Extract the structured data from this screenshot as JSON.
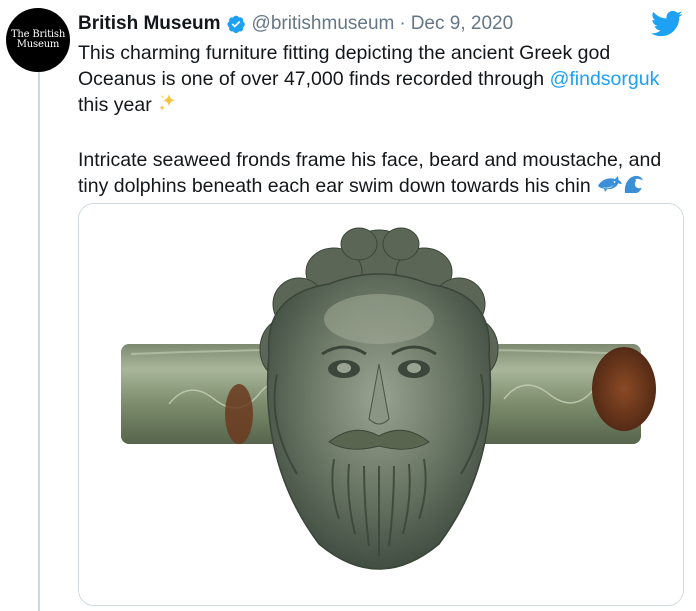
{
  "account": {
    "display_name": "British Museum",
    "handle": "@britishmuseum",
    "separator": "·",
    "date": "Dec 9, 2020",
    "avatar_logo_line1": "The British",
    "avatar_logo_line2": "Museum",
    "verified_icon": "verified-badge-icon"
  },
  "tweet": {
    "text_part1": "This charming furniture fitting depicting the ancient Greek god Oceanus is one of over 47,000 finds recorded through ",
    "mention": "@findsorguk",
    "text_part2": " this year",
    "text_paragraph2": "Intricate seaweed fronds frame his face, beard and moustache, and tiny dolphins beneath each ear swim down towards his chin",
    "emoji_1": "sparkles-icon",
    "emoji_2": "dolphin-icon",
    "emoji_3": "wave-icon"
  },
  "media": {
    "description_icon": "bronze-oceanus-mask-photo"
  },
  "colors": {
    "link": "#1da1f2",
    "secondary_text": "#657786",
    "primary_text": "#14171a",
    "border": "#cfd9de"
  }
}
